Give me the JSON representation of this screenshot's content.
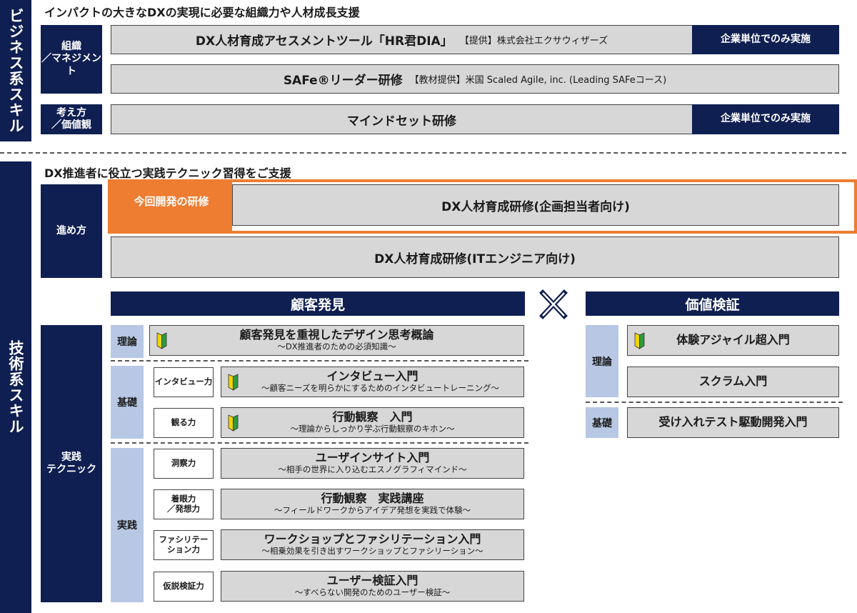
{
  "business": {
    "band_label": "ビジネス系スキル",
    "heading": "インパクトの大きなDXの実現に必要な組織力や人材成長支援",
    "categories": {
      "organization": "組織\n／マネジメント",
      "mindset": "考え方\n／価値観"
    },
    "rows": [
      {
        "title": "DX人材育成アセスメントツール「HR君DIA」",
        "note": "【提供】株式会社エクサウィザーズ",
        "tag": "企業単位でのみ実施"
      },
      {
        "title": "SAFe®リーダー研修",
        "note": "【教材提供】米国 Scaled Agile, inc. (Leading SAFeコース)"
      },
      {
        "title": "マインドセット研修",
        "tag": "企業単位でのみ実施"
      }
    ]
  },
  "tech": {
    "band_label": "技術系スキル",
    "heading": "DX推進者に役立つ実践テクニック習得をご支援",
    "approach_label": "進め方",
    "new_label": "今回開発の研修",
    "approach_rows": [
      "DX人材育成研修(企画担当者向け)",
      "DX人材育成研修(ITエンジニア向け)"
    ],
    "practice_label": "実践\nテクニック",
    "cross_symbol": "✕",
    "customer": {
      "title": "顧客発見",
      "levels": {
        "theory": "理論",
        "basic": "基礎",
        "practice": "実践"
      },
      "items": [
        {
          "skill": "",
          "title": "顧客発見を重視したデザイン思考概論",
          "sub": "～DX推進者のための必須知識～"
        },
        {
          "skill": "インタビュー力",
          "title": "インタビュー入門",
          "sub": "～顧客ニーズを明らかにするためのインタビュートレーニング～"
        },
        {
          "skill": "観る力",
          "title": "行動観察　入門",
          "sub": "～理論からしっかり学ぶ行動観察のキホン～"
        },
        {
          "skill": "洞察力",
          "title": "ユーザインサイト入門",
          "sub": "～相手の世界に入り込むエスノグラフィマインド～"
        },
        {
          "skill": "着眼力\n／発想力",
          "title": "行動観察　実践講座",
          "sub": "～フィールドワークからアイデア発想を実践で体験～"
        },
        {
          "skill": "ファシリテー\nション力",
          "title": "ワークショップとファシリテーション入門",
          "sub": "～相乗効果を引き出すワークショップとファシリーション～"
        },
        {
          "skill": "仮説検証力",
          "title": "ユーザー検証入門",
          "sub": "～すべらない開発のためのユーザー検証～"
        }
      ]
    },
    "value": {
      "title": "価値検証",
      "levels": {
        "theory": "理論",
        "basic": "基礎"
      },
      "items": [
        "体験アジャイル超入門",
        "スクラム入門",
        "受け入れテスト駆動開発入門"
      ]
    }
  },
  "colors": {
    "navy": "#0f1f52",
    "orange": "#ee7d31",
    "gray": "#d7d7d7",
    "light_blue": "#b7c7e4"
  }
}
